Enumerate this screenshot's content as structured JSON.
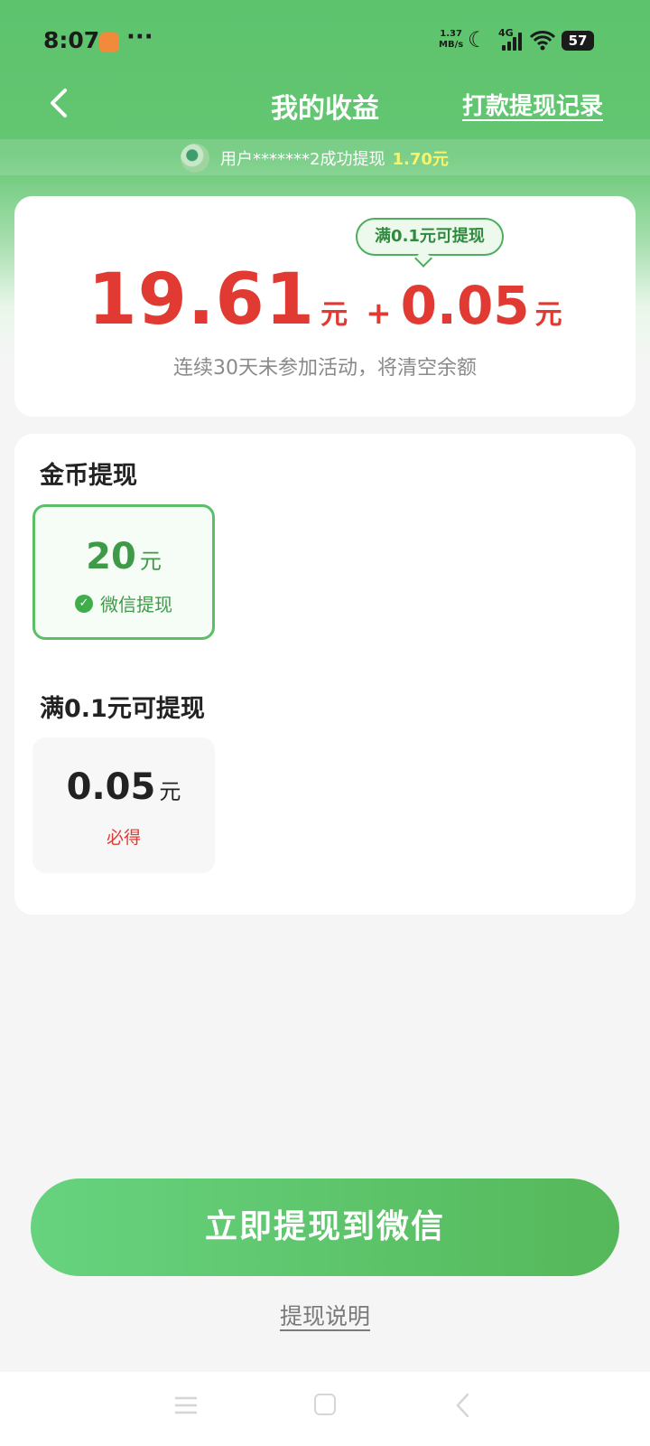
{
  "status": {
    "time": "8:07",
    "dots": "···",
    "speed_value": "1.37",
    "speed_unit": "MB/s",
    "network": "4G",
    "battery": "57"
  },
  "nav": {
    "title": "我的收益",
    "record_link": "打款提现记录"
  },
  "ticker": {
    "text": "用户*******2成功提现",
    "amount": "1.70元"
  },
  "balance": {
    "tooltip": "满0.1元可提现",
    "main": "19.61",
    "unit": "元",
    "plus": "+",
    "extra": "0.05",
    "extra_unit": "元",
    "warning": "连续30天未参加活动，将清空余额"
  },
  "withdraw": {
    "coin_section_title": "金币提现",
    "coin_option": {
      "amount": "20",
      "unit": "元",
      "method": "微信提现"
    },
    "min_section_title": "满0.1元可提现",
    "min_option": {
      "amount": "0.05",
      "unit": "元",
      "tag": "必得"
    }
  },
  "cta": {
    "label": "立即提现到微信"
  },
  "help_link": "提现说明",
  "colors": {
    "brand_green": "#5ec36d",
    "amount_red": "#e03a32",
    "yellow_highlight": "#f9f36a"
  }
}
